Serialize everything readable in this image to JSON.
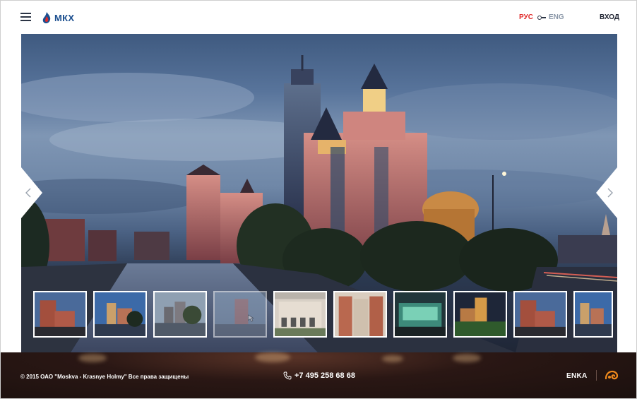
{
  "header": {
    "logo_text": "МКХ",
    "lang_ru": "РУС",
    "lang_en": "ENG",
    "login_label": "ВХОД",
    "colors": {
      "accent": "#e02a2a",
      "brand": "#1c4f8f"
    }
  },
  "gallery": {
    "prev_icon": "chevron-left-icon",
    "next_icon": "chevron-right-icon",
    "thumbnails_count": 10,
    "active_index": 3
  },
  "footer": {
    "copyright": "© 2015 ОАО \"Moskva - Krasnye Holmy\" Все права защищены",
    "phone": "+7 495 258 68 68",
    "partner_name": "ENKA"
  }
}
